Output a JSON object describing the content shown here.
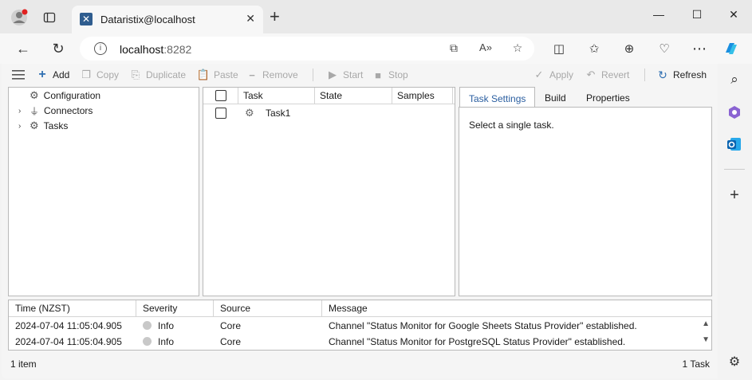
{
  "browser": {
    "tab_title": "Dataristix@localhost",
    "url_host": "localhost",
    "url_port": ":8282"
  },
  "toolbar": {
    "add": "Add",
    "copy": "Copy",
    "duplicate": "Duplicate",
    "paste": "Paste",
    "remove": "Remove",
    "start": "Start",
    "stop": "Stop",
    "apply": "Apply",
    "revert": "Revert",
    "refresh": "Refresh"
  },
  "tree": {
    "items": [
      {
        "label": "Configuration",
        "expandable": false
      },
      {
        "label": "Connectors",
        "expandable": true
      },
      {
        "label": "Tasks",
        "expandable": true
      }
    ]
  },
  "task_grid": {
    "columns": [
      "Task",
      "State",
      "Samples"
    ],
    "rows": [
      {
        "task": "Task1",
        "state": "",
        "samples": ""
      }
    ]
  },
  "right_panel": {
    "tabs": [
      "Task Settings",
      "Build",
      "Properties"
    ],
    "active_tab": "Task Settings",
    "message": "Select a single task."
  },
  "log": {
    "columns": [
      "Time (NZST)",
      "Severity",
      "Source",
      "Message"
    ],
    "rows": [
      {
        "time": "2024-07-04 11:05:04.905",
        "severity": "Info",
        "source": "Core",
        "message": "Channel \"Status Monitor for Google Sheets Status Provider\" established."
      },
      {
        "time": "2024-07-04 11:05:04.905",
        "severity": "Info",
        "source": "Core",
        "message": "Channel \"Status Monitor for PostgreSQL Status Provider\" established."
      }
    ]
  },
  "status": {
    "left": "1 item",
    "right": "1 Task"
  },
  "colors": {
    "accent": "#2a5ea0",
    "refresh_icon": "#2f6fb2",
    "add_icon": "#2f6fb2"
  }
}
